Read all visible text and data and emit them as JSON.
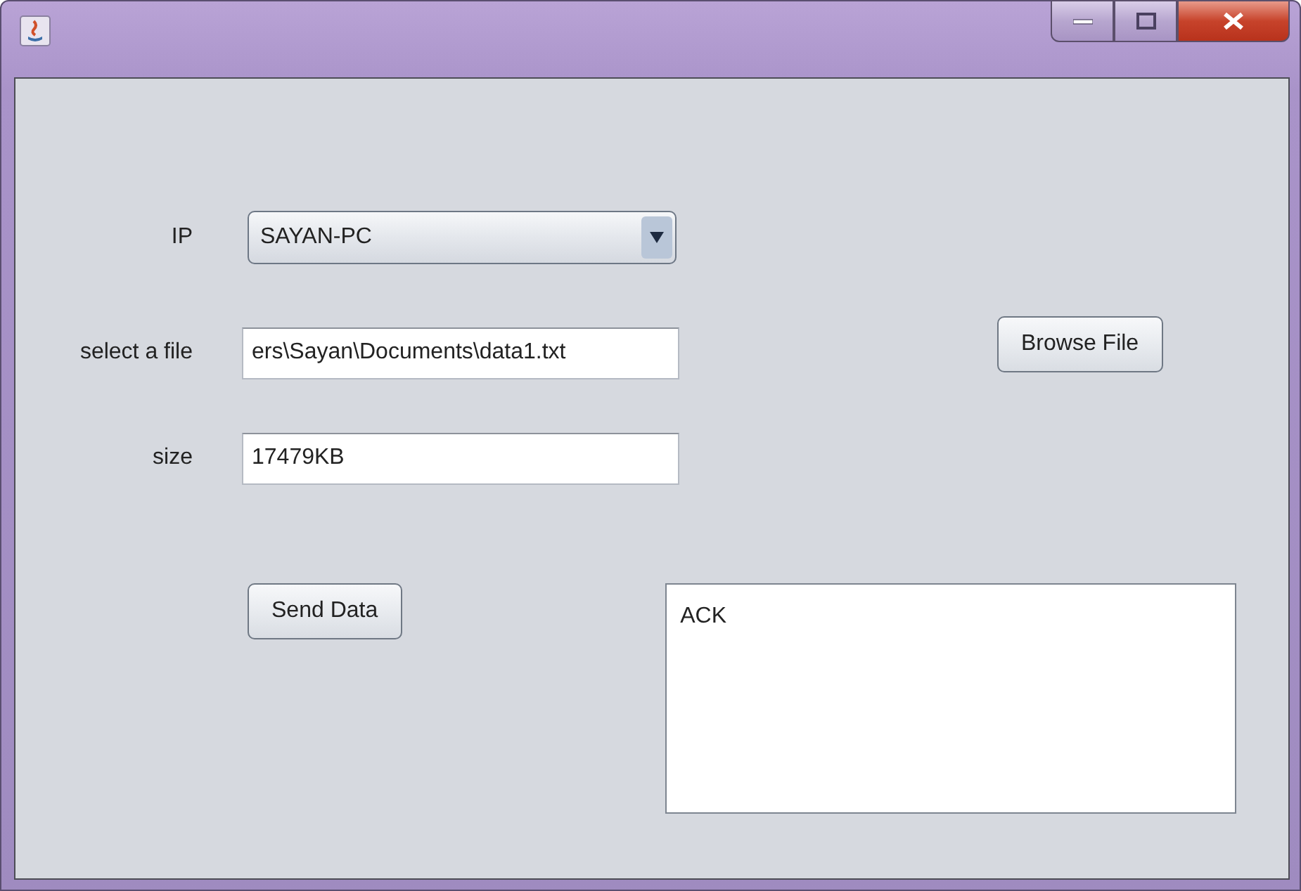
{
  "window": {
    "controls": [
      {
        "kind": "minimize"
      },
      {
        "kind": "maximize"
      },
      {
        "kind": "close"
      }
    ]
  },
  "ip": {
    "label": "IP",
    "value": "SAYAN-PC"
  },
  "file": {
    "label": "select a file",
    "value": "ers\\Sayan\\Documents\\data1.txt",
    "button": "Browse File"
  },
  "size": {
    "label": "size",
    "value": "17479KB"
  },
  "send_button": "Send Data",
  "output": {
    "value": "ACK"
  }
}
